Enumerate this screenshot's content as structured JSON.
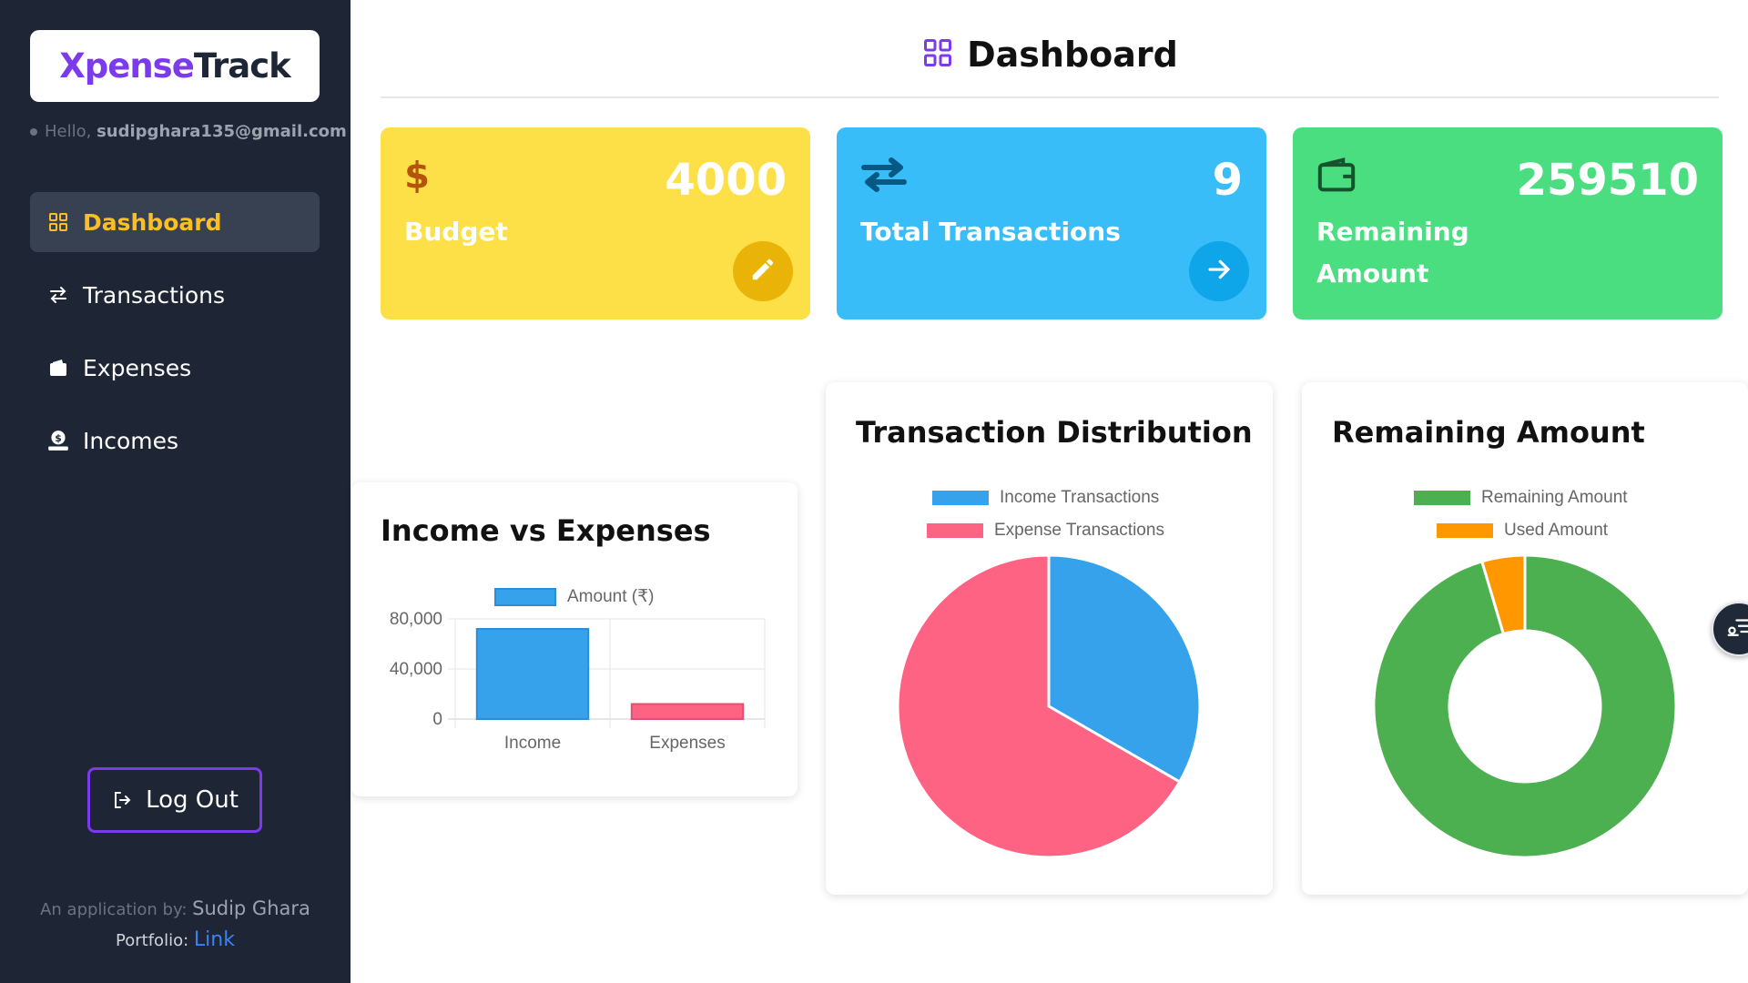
{
  "brand": {
    "part1": "Xpense",
    "part2": "Track"
  },
  "user": {
    "greeting": "Hello,",
    "email": "sudipghara135@gmail.com"
  },
  "nav": [
    {
      "label": "Dashboard",
      "icon": "grid-icon",
      "active": true
    },
    {
      "label": "Transactions",
      "icon": "arrows-icon",
      "active": false
    },
    {
      "label": "Expenses",
      "icon": "wallet-icon",
      "active": false
    },
    {
      "label": "Incomes",
      "icon": "income-icon",
      "active": false
    }
  ],
  "logout_label": "Log Out",
  "credit": {
    "prefix": "An application by:",
    "name": "Sudip Ghara",
    "portfolio_label": "Portfolio:",
    "link_label": "Link"
  },
  "header": {
    "title": "Dashboard"
  },
  "cards": {
    "budget": {
      "label": "Budget",
      "value": "4000",
      "color": "#fde047",
      "icon": "dollar-icon",
      "action": "edit-icon"
    },
    "transactions": {
      "label": "Total Transactions",
      "value": "9",
      "color": "#38bdf8",
      "icon": "swap-icon",
      "action": "arrow-right-icon"
    },
    "remaining": {
      "label": "Remaining Amount",
      "value": "259510",
      "color": "#4ade80",
      "icon": "wallet-icon"
    }
  },
  "colors": {
    "sidebar": "#1e2535",
    "accent": "#7c3aed",
    "active_text": "#fbbf24",
    "blue": "#36a2eb",
    "pink": "#ff6384",
    "green": "#4caf50",
    "orange": "#ff9800"
  },
  "chart_data": [
    {
      "type": "bar",
      "title": "Income vs Expenses",
      "categories": [
        "Income",
        "Expenses"
      ],
      "series": [
        {
          "name": "Amount (₹)",
          "values": [
            72000,
            12000
          ]
        }
      ],
      "yticks": [
        "80,000",
        "40,000",
        "0"
      ],
      "ylim": [
        0,
        80000
      ],
      "grid": true,
      "legend": "top"
    },
    {
      "type": "pie",
      "title": "Transaction Distribution",
      "labels": [
        "Income Transactions",
        "Expense Transactions"
      ],
      "values": [
        3,
        6
      ],
      "legend": "top"
    },
    {
      "type": "pie",
      "title": "Remaining Amount",
      "labels": [
        "Remaining Amount",
        "Used Amount"
      ],
      "values": [
        259510,
        12490
      ],
      "legend": "top"
    }
  ]
}
